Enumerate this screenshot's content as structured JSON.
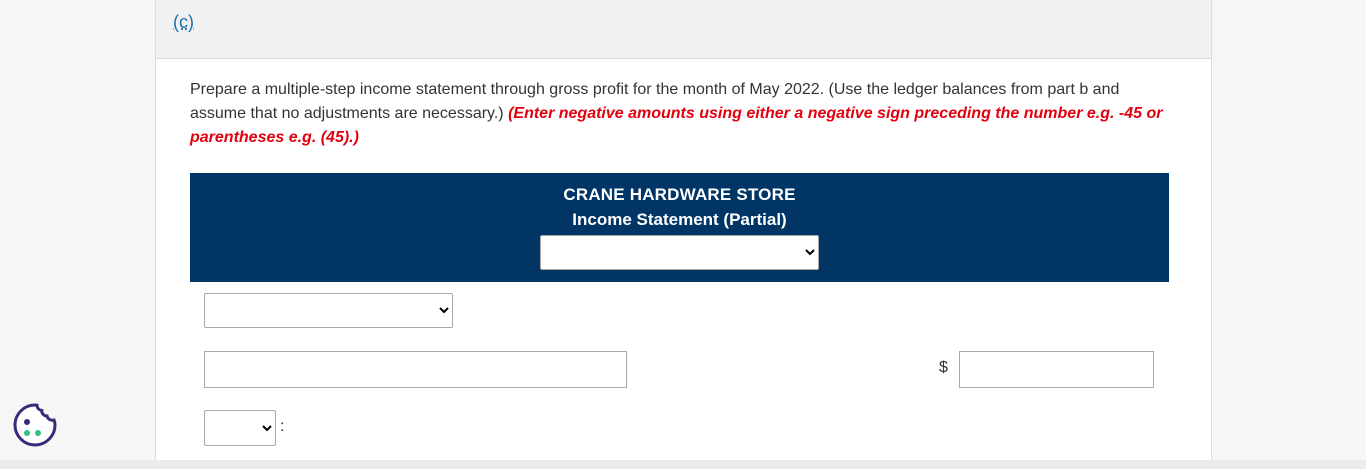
{
  "part": {
    "label": "(c)"
  },
  "instructions": {
    "text": "Prepare a multiple-step income statement through gross profit for the month of May 2022. (Use the ledger balances from part b and assume that no adjustments are necessary.) ",
    "note": "(Enter negative amounts using either a negative sign preceding the number e.g. -45 or parentheses e.g. (45).)"
  },
  "statement": {
    "company": "CRANE HARDWARE STORE",
    "title": "Income Statement (Partial)",
    "period_select": {
      "value": ""
    }
  },
  "rows": {
    "row1_select": {
      "value": ""
    },
    "row2_input": {
      "value": ""
    },
    "currency_symbol": "$",
    "row2_amount": {
      "value": ""
    },
    "row3_select": {
      "value": ""
    },
    "row3_colon": ":"
  },
  "icons": {
    "cookie": "cookie-icon"
  },
  "colors": {
    "header_bg": "#003566",
    "note_red": "#e3000f",
    "link_blue": "#1a6fb0",
    "cookie_purple": "#3b2a78",
    "cookie_green": "#2ec27e"
  }
}
